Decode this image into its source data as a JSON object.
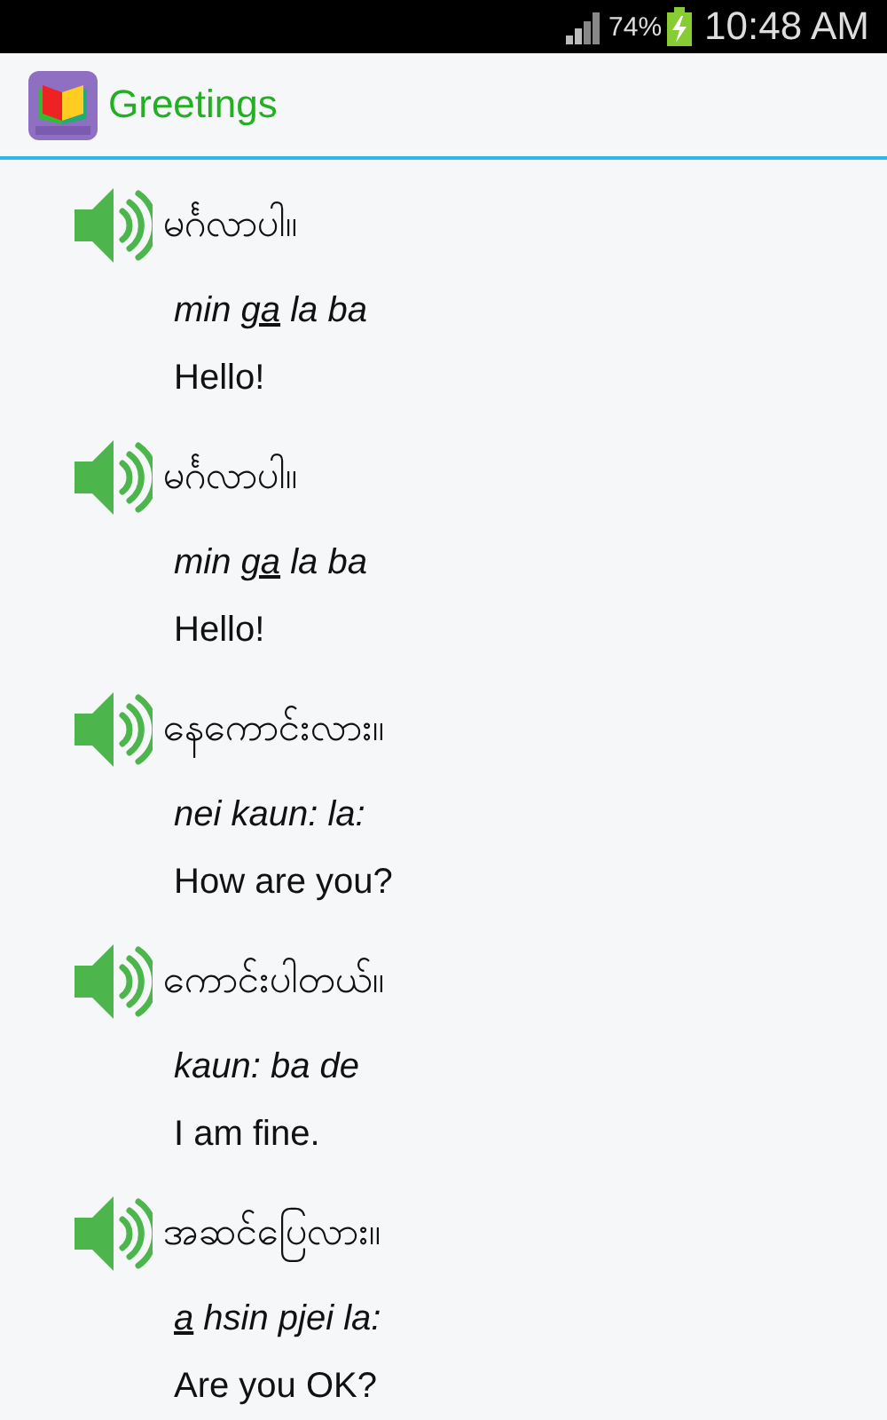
{
  "status_bar": {
    "battery": "74%",
    "time": "10:48 AM"
  },
  "app_bar": {
    "title": "Greetings"
  },
  "phrases": [
    {
      "native": "မင်္ဂလာပါ။",
      "romanization": [
        {
          "text": "min "
        },
        {
          "text": "ga",
          "underline": true
        },
        {
          "text": " la ba"
        }
      ],
      "english": "Hello!"
    },
    {
      "native": "မင်္ဂလာပါ။",
      "romanization": [
        {
          "text": "min "
        },
        {
          "text": "ga",
          "underline": true
        },
        {
          "text": " la ba"
        }
      ],
      "english": "Hello!"
    },
    {
      "native": "နေကောင်းလား။",
      "romanization": [
        {
          "text": "nei kaun: la:"
        }
      ],
      "english": "How are you?"
    },
    {
      "native": "ကောင်းပါတယ်။",
      "romanization": [
        {
          "text": "kaun: ba de"
        }
      ],
      "english": "I am fine."
    },
    {
      "native": "အဆင်ပြေလား။",
      "romanization": [
        {
          "text": "a",
          "underline": true
        },
        {
          "text": " hsin pjei la:"
        }
      ],
      "english": "Are you OK?"
    }
  ]
}
